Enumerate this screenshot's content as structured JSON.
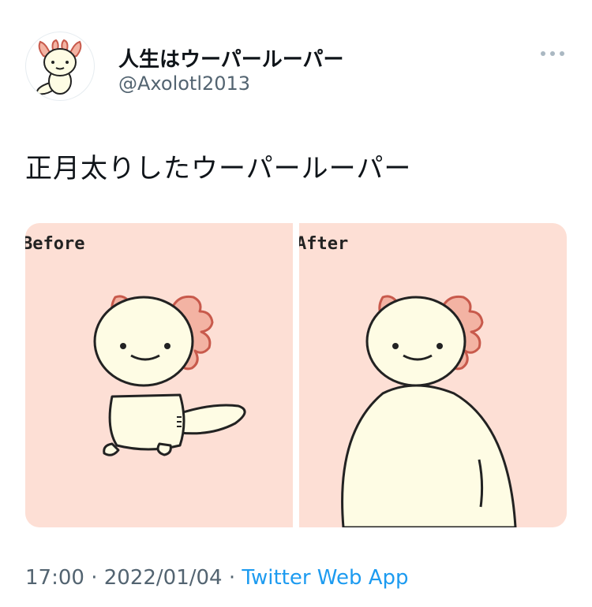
{
  "author": {
    "display_name": "人生はウーパールーパー",
    "handle": "@Axolotl2013",
    "avatar_icon": "axolotl-avatar-icon"
  },
  "more_icon": "more-dots-icon",
  "tweet": {
    "text": "正月太りしたウーパールーパー"
  },
  "media": {
    "panels": [
      {
        "label": "Before"
      },
      {
        "label": "After"
      }
    ],
    "colors": {
      "background": "#fddfd5",
      "axolotl_body": "#fefce4",
      "gills": "#f3b3a3",
      "gill_outline": "#c85a4c"
    }
  },
  "meta": {
    "time": "17:00",
    "sep1": " · ",
    "date": "2022/01/04",
    "sep2": " · ",
    "source": "Twitter Web App"
  },
  "colors": {
    "link": "#1d9bf0",
    "muted": "#536471",
    "text": "#0f1419"
  }
}
